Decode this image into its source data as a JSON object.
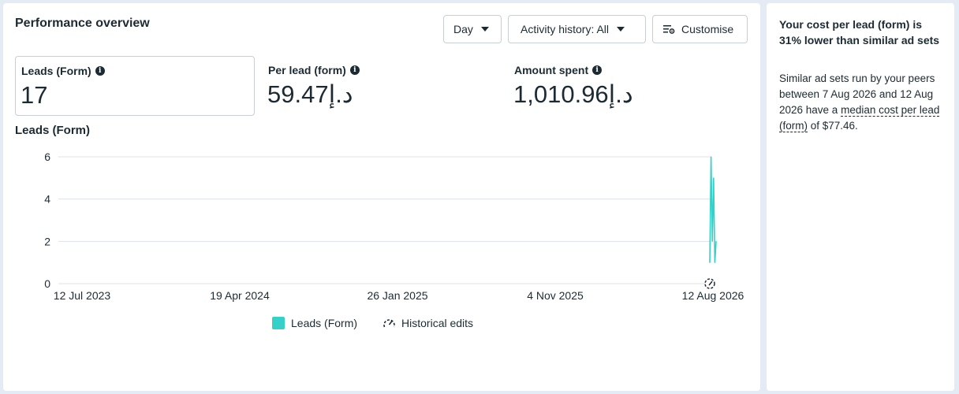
{
  "overview": {
    "title": "Performance overview",
    "day_label": "Day",
    "activity_label": "Activity history: All",
    "customise_label": "Customise"
  },
  "metrics": [
    {
      "label": "Leads (Form)",
      "value": "17"
    },
    {
      "label": "Per lead (form)",
      "value": "59.47د.إ"
    },
    {
      "label": "Amount spent",
      "value": "1,010.96د.إ"
    }
  ],
  "chart_title": "Leads (Form)",
  "legend": {
    "series_label": "Leads (Form)",
    "edits_label": "Historical edits"
  },
  "colors": {
    "series": "#35d0c8",
    "grid": "#dde2e7",
    "text": "#1c2b33"
  },
  "chart_data": {
    "type": "line",
    "title": "Leads (Form)",
    "xlabel": "",
    "ylabel": "",
    "x_ticks": [
      "12 Jul 2023",
      "19 Apr 2024",
      "26 Jan 2025",
      "4 Nov 2025",
      "12 Aug 2026"
    ],
    "y_ticks": [
      0,
      2,
      4,
      6
    ],
    "ylim": [
      0,
      6
    ],
    "grid": true,
    "legend": "bottom",
    "series": [
      {
        "name": "Leads (Form)",
        "x": [
          "7 Aug 2026",
          "8 Aug 2026",
          "9 Aug 2026",
          "10 Aug 2026",
          "11 Aug 2026",
          "12 Aug 2026"
        ],
        "values": [
          1,
          6,
          2,
          5,
          1,
          2
        ]
      }
    ]
  },
  "side": {
    "heading": "Your cost per lead (form) is 31% lower than similar ad sets",
    "body_prefix": "Similar ad sets run by your peers between 7 Aug 2026 and 12 Aug 2026 have a ",
    "body_link": "median cost per lead (form)",
    "body_suffix": " of $77.46."
  }
}
